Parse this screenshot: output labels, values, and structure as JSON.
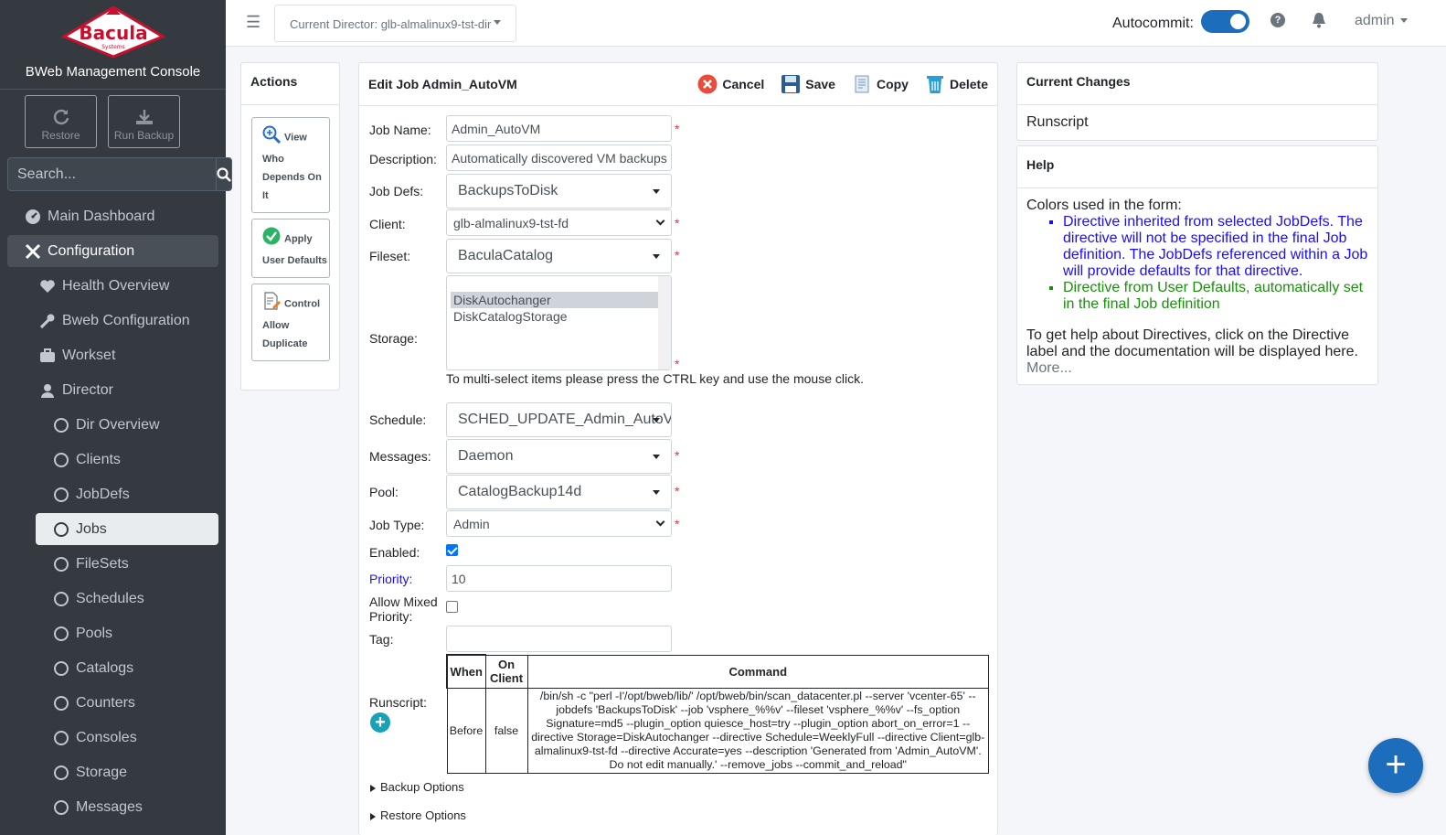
{
  "brand": {
    "logo_text": "Bacula",
    "logo_sub": "Systems",
    "title": "BWeb Management Console"
  },
  "quick_actions": [
    {
      "label": "Restore",
      "icon": "refresh-icon"
    },
    {
      "label": "Run Backup",
      "icon": "download-icon"
    }
  ],
  "search": {
    "placeholder": "Search..."
  },
  "nav": [
    {
      "label": "Main Dashboard",
      "icon": "dashboard-icon",
      "level": 0,
      "active": false
    },
    {
      "label": "Configuration",
      "icon": "tools-icon",
      "level": 0,
      "active": true
    },
    {
      "label": "Health Overview",
      "icon": "heartbeat-icon",
      "level": 1
    },
    {
      "label": "Bweb Configuration",
      "icon": "wrench-icon",
      "level": 1
    },
    {
      "label": "Workset",
      "icon": "briefcase-icon",
      "level": 1
    },
    {
      "label": "Director",
      "icon": "user-icon",
      "level": 1
    },
    {
      "label": "Dir Overview",
      "level": 2
    },
    {
      "label": "Clients",
      "level": 2
    },
    {
      "label": "JobDefs",
      "level": 2
    },
    {
      "label": "Jobs",
      "level": 2,
      "active": true
    },
    {
      "label": "FileSets",
      "level": 2
    },
    {
      "label": "Schedules",
      "level": 2
    },
    {
      "label": "Pools",
      "level": 2
    },
    {
      "label": "Catalogs",
      "level": 2
    },
    {
      "label": "Counters",
      "level": 2
    },
    {
      "label": "Consoles",
      "level": 2
    },
    {
      "label": "Storage",
      "level": 2
    },
    {
      "label": "Messages",
      "level": 2
    }
  ],
  "header": {
    "director": "Current Director: glb-almalinux9-tst-dir",
    "autocommit_label": "Autocommit:",
    "autocommit_on": true,
    "user": "admin"
  },
  "actions": {
    "title": "Actions",
    "items": [
      {
        "label": "View Who Depends On It",
        "icon": "magnify-icon"
      },
      {
        "label": "Apply User Defaults",
        "icon": "check-circle-icon"
      },
      {
        "label": "Control Allow Duplicate",
        "icon": "edit-document-icon"
      }
    ]
  },
  "edit": {
    "title": "Edit Job Admin_AutoVM",
    "toolbar": {
      "cancel": "Cancel",
      "save": "Save",
      "copy": "Copy",
      "delete": "Delete"
    },
    "fields": {
      "job_name": {
        "label": "Job Name:",
        "value": "Admin_AutoVM"
      },
      "description": {
        "label": "Description:",
        "value": "Automatically discovered VM backups"
      },
      "job_defs": {
        "label": "Job Defs:",
        "value": "BackupsToDisk"
      },
      "client": {
        "label": "Client:",
        "value": "glb-almalinux9-tst-fd"
      },
      "fileset": {
        "label": "Fileset:",
        "value": "BaculaCatalog"
      },
      "storage": {
        "label": "Storage:",
        "options": [
          "DiskAutochanger",
          "DiskCatalogStorage"
        ],
        "selected": "DiskAutochanger"
      },
      "storage_hint": "To multi-select items please press the CTRL key and use the mouse click.",
      "schedule": {
        "label": "Schedule:",
        "value": "SCHED_UPDATE_Admin_AutoVM"
      },
      "messages": {
        "label": "Messages:",
        "value": "Daemon"
      },
      "pool": {
        "label": "Pool:",
        "value": "CatalogBackup14d"
      },
      "job_type": {
        "label": "Job Type:",
        "value": "Admin"
      },
      "enabled": {
        "label": "Enabled:",
        "checked": true
      },
      "priority": {
        "label": "Priority:",
        "value": "10"
      },
      "allow_mixed": {
        "label": "Allow Mixed Priority:",
        "checked": false
      },
      "tag": {
        "label": "Tag:",
        "value": ""
      }
    },
    "runscript": {
      "label": "Runscript:",
      "headers": [
        "When",
        "On Client",
        "Command"
      ],
      "rows": [
        {
          "when": "Before",
          "on_client": "false",
          "command": "/bin/sh -c \"perl -I'/opt/bweb/lib/' /opt/bweb/bin/scan_datacenter.pl --server 'vcenter-65' --jobdefs 'BackupsToDisk' --job 'vsphere_%%v' --fileset 'vsphere_%%v' --fs_option Signature=md5 --plugin_option quiesce_host=try --plugin_option abort_on_error=1 --directive Storage=DiskAutochanger --directive Schedule=WeeklyFull --directive Client=glb-almalinux9-tst-fd --directive Accurate=yes --description 'Generated from 'Admin_AutoVM'. Do not edit manually.' --remove_jobs --commit_and_reload\""
        }
      ]
    },
    "sections": [
      "Backup Options",
      "Restore Options"
    ]
  },
  "changes": {
    "title": "Current Changes",
    "items": [
      "Runscript"
    ]
  },
  "help": {
    "title": "Help",
    "intro": "Colors used in the form:",
    "items": [
      {
        "text": "Directive inherited from selected JobDefs. The directive will not be specified in the final Job definition. The JobDefs referenced within a Job will provide defaults for that directive.",
        "color": "#1a0dff"
      },
      {
        "text": "Directive from User Defaults, automatically set in the final Job definition",
        "color": "#1a8f0d"
      }
    ],
    "outro": "To get help about Directives, click on the Directive label and the documentation will be displayed here.",
    "more": "More..."
  },
  "fab": "+"
}
